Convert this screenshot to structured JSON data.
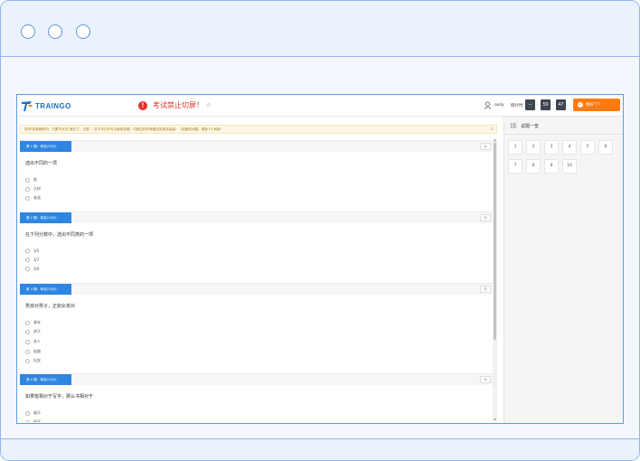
{
  "app": {
    "logo_text": "TRAINGO",
    "warning_text": "考试禁止切屏！",
    "warning_small": "⊘",
    "user_name": "aaily",
    "timer_label": "倒计时",
    "timer": {
      "h": "--",
      "m": "59",
      "s": "47"
    },
    "submit_label": "我好了！"
  },
  "notice": {
    "text": "您好!答卷期间切，只要不点击“我好了，交卷”，您下次打开可以继续答题，切换过的所有题目答案会保留！（如遇到问题，请按 F5 刷新）",
    "close": "×"
  },
  "questions": [
    {
      "tag": "第 1 题：单选(10分)",
      "title": "选出不同的一项",
      "options": [
        "蛇",
        "大树",
        "老虎"
      ]
    },
    {
      "tag": "第 2 题：单选(10分)",
      "title": "在下列分数中，选出不同类的一项",
      "options": [
        "3/5",
        "3/7",
        "3/9"
      ]
    },
    {
      "tag": "第 3 题：单选(10分)",
      "title": "男孩对男子，正如女孩对",
      "options": [
        "青年",
        "孩子",
        "夫人",
        "姑娘",
        "妇女"
      ]
    },
    {
      "tag": "第 4 题：单选(10分)",
      "title": "如果笔相对于写字，那么书相对于",
      "options": [
        "娱乐",
        "阅读"
      ]
    }
  ],
  "flag_label": "标",
  "sidebar": {
    "title": "试题一览",
    "numbers": [
      "1",
      "2",
      "3",
      "4",
      "5",
      "6",
      "7",
      "8",
      "9",
      "10"
    ]
  },
  "colors": {
    "accent": "#2e86e2",
    "warning": "#e0322b",
    "submit": "#ff7a12",
    "frame": "#8fb7ec"
  }
}
